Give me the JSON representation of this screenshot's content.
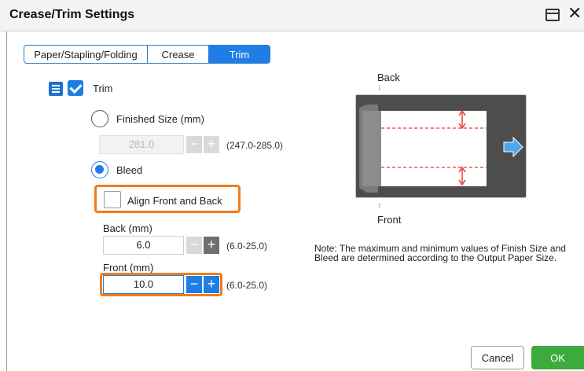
{
  "window": {
    "title": "Crease/Trim Settings",
    "close_glyph": "✕"
  },
  "tabs": [
    {
      "label": "Paper/Stapling/Folding",
      "active": false
    },
    {
      "label": "Crease",
      "active": false
    },
    {
      "label": "Trim",
      "active": true
    }
  ],
  "trim": {
    "label": "Trim",
    "checked": true,
    "finished_size": {
      "label": "Finished Size (mm)",
      "selected": false,
      "value": "281.0",
      "range": "(247.0-285.0)",
      "disabled": true
    },
    "bleed": {
      "label": "Bleed",
      "selected": true
    },
    "align": {
      "label": "Align Front and Back",
      "checked": false
    },
    "back": {
      "label": "Back (mm)",
      "value": "6.0",
      "range": "(6.0-25.0)"
    },
    "front": {
      "label": "Front (mm)",
      "value": "10.0",
      "range": "(6.0-25.0)"
    }
  },
  "stepper": {
    "minus": "−",
    "plus": "+"
  },
  "diagram": {
    "back_label": "Back",
    "front_label": "Front",
    "arrow_down": "↓",
    "arrow_up": "↑"
  },
  "note": "Note: The maximum and minimum values of Finish Size and Bleed are determined according to the Output Paper Size.",
  "buttons": {
    "cancel": "Cancel",
    "ok": "OK"
  },
  "colors": {
    "accent": "#1f7de6",
    "highlight": "#f07d1c",
    "ok": "#3caa3c",
    "trim_line": "#e53935"
  },
  "icons": [
    "window-icon",
    "close-icon",
    "trim-icon",
    "check-icon",
    "arrow-right-icon"
  ]
}
